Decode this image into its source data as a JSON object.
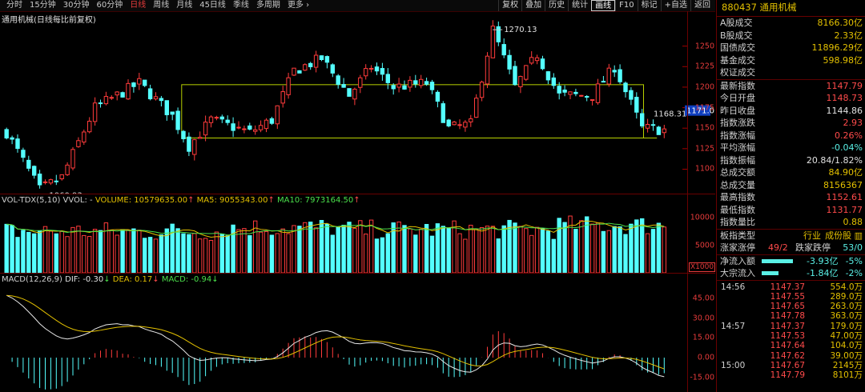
{
  "toolbar": {
    "periods": [
      "分时",
      "15分钟",
      "30分钟",
      "60分钟",
      "日线",
      "周线",
      "月线",
      "45日线",
      "季线",
      "多周期",
      "更多 ›"
    ],
    "active_period": "日线",
    "functions": [
      "复权",
      "叠加",
      "历史",
      "统计",
      "画线",
      "F10",
      "标记",
      "+自选",
      "返回"
    ],
    "active_function": "画线"
  },
  "price_pane": {
    "title": "通用机械(日线每比前复权)",
    "yticks": [
      "1250",
      "1225",
      "1200",
      "1175",
      "1150",
      "1125",
      "1100"
    ],
    "high_label": "1270.13",
    "low_label": "1060.93",
    "right_label": "1168.31",
    "cursor_price": "1171.0"
  },
  "vol_pane": {
    "title_name": "VOL-TDX(5,10) VVOL: -",
    "volume_label": "VOLUME: 10579635.00",
    "ma5_label": "MA5: 9055343.00",
    "ma10_label": "MA10: 7973164.50",
    "yticks": [
      "10000",
      "5000"
    ],
    "unit": "X1000"
  },
  "macd_pane": {
    "title_name": "MACD(12,26,9)",
    "dif_label": "DIF: -0.30",
    "dea_label": "DEA: 0.17",
    "macd_label": "MACD: -0.94",
    "yticks": [
      "45.00",
      "30.00",
      "15.00",
      "0.00",
      "-15.00"
    ]
  },
  "side": {
    "header": "880437 通用机械",
    "turnover": [
      {
        "k": "A股成交",
        "v": "8166.30亿"
      },
      {
        "k": "B股成交",
        "v": "2.33亿"
      },
      {
        "k": "国债成交",
        "v": "11896.29亿"
      },
      {
        "k": "基金成交",
        "v": "598.98亿"
      },
      {
        "k": "权证成交",
        "v": ""
      }
    ],
    "quote": [
      {
        "k": "最新指数",
        "v": "1147.79",
        "c": "red"
      },
      {
        "k": "今日开盘",
        "v": "1148.73",
        "c": "red"
      },
      {
        "k": "昨日收盘",
        "v": "1144.86",
        "c": "wht"
      },
      {
        "k": "指数涨跌",
        "v": "2.93",
        "c": "red"
      },
      {
        "k": "指数涨幅",
        "v": "0.26%",
        "c": "red"
      },
      {
        "k": "平均涨幅",
        "v": "-0.04%",
        "c": "grn"
      },
      {
        "k": "指数振幅",
        "v": "20.84/1.82%",
        "c": "wht"
      },
      {
        "k": "总成交额",
        "v": "84.90亿",
        "c": "yel"
      },
      {
        "k": "总成交量",
        "v": "8156367",
        "c": "yel"
      },
      {
        "k": "最高指数",
        "v": "1152.61",
        "c": "red"
      },
      {
        "k": "最低指数",
        "v": "1131.77",
        "c": "red"
      },
      {
        "k": "指数量比",
        "v": "0.88",
        "c": "yel"
      }
    ],
    "board": {
      "k": "板指类型",
      "v1": "行业",
      "v2": "成份股"
    },
    "updown": {
      "k1": "涨家涨停",
      "v1": "49/2",
      "k2": "跌家跌停",
      "v2": "53/0"
    },
    "flows": [
      {
        "k": "净流入额",
        "v": "-3.93亿",
        "pct": "-5%",
        "fill": 0.85
      },
      {
        "k": "大宗流入",
        "v": "-1.84亿",
        "pct": "-2%",
        "fill": 0.45
      }
    ],
    "ticks": [
      {
        "t": "14:56",
        "p": "1147.37",
        "q": "554.0万"
      },
      {
        "t": "",
        "p": "1147.55",
        "q": "289.0万"
      },
      {
        "t": "",
        "p": "1147.65",
        "q": "263.0万"
      },
      {
        "t": "",
        "p": "1147.78",
        "q": "363.0万"
      },
      {
        "t": "14:57",
        "p": "1147.37",
        "q": "179.0万"
      },
      {
        "t": "",
        "p": "1147.53",
        "q": "47.00万"
      },
      {
        "t": "",
        "p": "1147.64",
        "q": "104.0万"
      },
      {
        "t": "",
        "p": "1147.62",
        "q": "39.00万"
      },
      {
        "t": "15:00",
        "p": "1147.67",
        "q": "2145万"
      },
      {
        "t": "",
        "p": "1147.79",
        "q": "8101万"
      }
    ]
  },
  "chart_data": {
    "type": "candlestick",
    "visible_extremes": {
      "high": 1270.13,
      "low": 1060.93
    },
    "ylim": [
      1080,
      1275
    ],
    "box_range": [
      1138,
      1203
    ],
    "last_close": 1147.79,
    "volume_ylim_x1000": [
      0,
      12500
    ],
    "macd_ylim": [
      -25,
      58
    ]
  }
}
